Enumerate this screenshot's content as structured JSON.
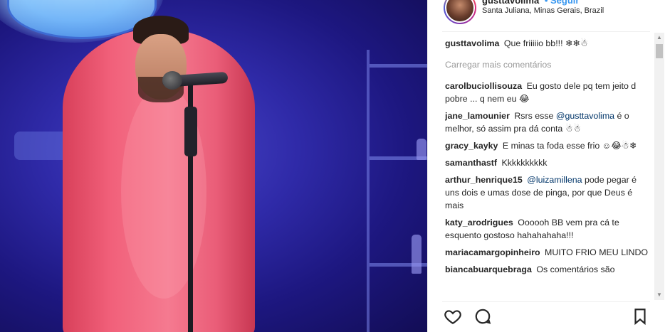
{
  "post": {
    "username": "gusttavolima",
    "follow_label": "• Seguir",
    "location": "Santa Juliana, Minas Gerais, Brazil"
  },
  "comments": {
    "load_more_label": "Carregar mais comentários",
    "items": [
      {
        "user": "gusttavolima",
        "text": "Que friiiiio bb!!! ❄❄☃"
      },
      {
        "user": "carolbuciollisouza",
        "text": "Eu gosto dele pq tem jeito d pobre ... q nem eu 😂"
      },
      {
        "user": "jane_lamounier",
        "text_before": "Rsrs esse ",
        "mention": "@gusttavolima",
        "text_after": " é o melhor, só assim pra dá conta ☃☃"
      },
      {
        "user": "gracy_kayky",
        "text": "E minas ta foda esse frio ☺😂☃❄"
      },
      {
        "user": "samanthastf",
        "text": "Kkkkkkkkkk"
      },
      {
        "user": "arthur_henrique15",
        "text_before": "",
        "mention": "@luizamillena",
        "text_after": " pode pegar é uns dois e umas dose de pinga, por que Deus é mais"
      },
      {
        "user": "katy_arodrigues",
        "text": "Oooooh BB vem pra cá te esquento gostoso hahahahaha!!!"
      },
      {
        "user": "mariacamargopinheiro",
        "text": "MUITO FRIO MEU LINDO"
      },
      {
        "user": "biancabuarquebraga",
        "text": "Os comentários são"
      }
    ]
  },
  "icons": {
    "like": "heart-icon",
    "comment": "comment-bubble-icon",
    "save": "bookmark-icon"
  },
  "colors": {
    "link": "#003569",
    "muted": "#999999",
    "text": "#262626"
  }
}
